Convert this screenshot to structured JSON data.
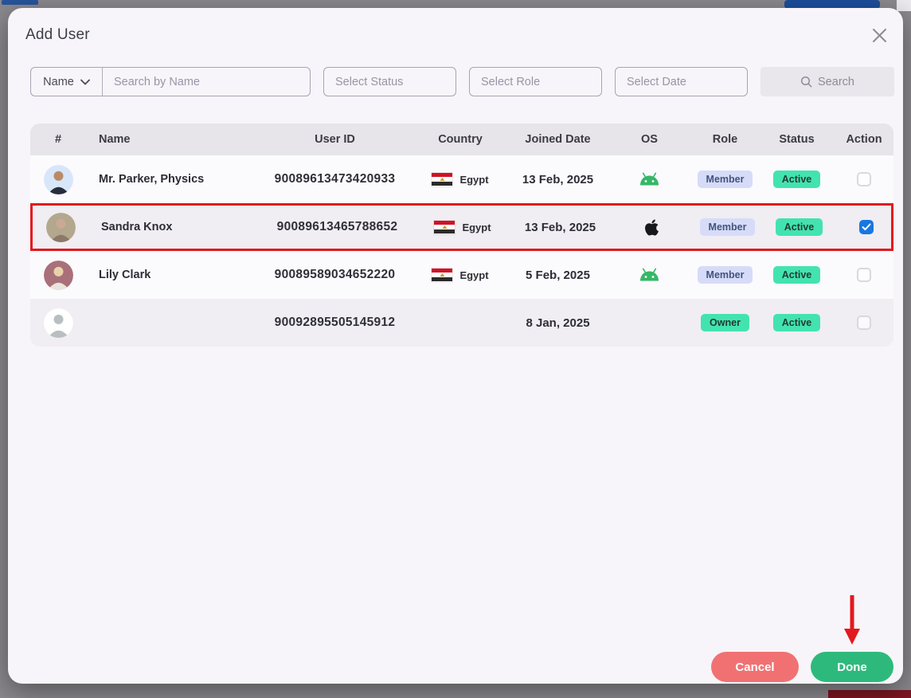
{
  "modal": {
    "title": "Add User"
  },
  "filters": {
    "name_dropdown_label": "Name",
    "search_placeholder": "Search by Name",
    "status_placeholder": "Select Status",
    "role_placeholder": "Select Role",
    "date_placeholder": "Select Date",
    "search_button_label": "Search"
  },
  "table": {
    "columns": [
      "#",
      "Name",
      "User ID",
      "Country",
      "Joined Date",
      "OS",
      "Role",
      "Status",
      "Action"
    ],
    "rows": [
      {
        "name": "Mr. Parker, Physics",
        "user_id": "90089613473420933",
        "country": "Egypt",
        "joined_date": "13 Feb, 2025",
        "os": "android",
        "role": "Member",
        "status": "Active",
        "checked": false,
        "highlighted": false,
        "avatar": "parker"
      },
      {
        "name": "Sandra Knox",
        "user_id": "90089613465788652",
        "country": "Egypt",
        "joined_date": "13 Feb, 2025",
        "os": "apple",
        "role": "Member",
        "status": "Active",
        "checked": true,
        "highlighted": true,
        "avatar": "sandra"
      },
      {
        "name": "Lily Clark",
        "user_id": "90089589034652220",
        "country": "Egypt",
        "joined_date": "5 Feb, 2025",
        "os": "android",
        "role": "Member",
        "status": "Active",
        "checked": false,
        "highlighted": false,
        "avatar": "lily"
      },
      {
        "name": "",
        "user_id": "90092895505145912",
        "country": "",
        "joined_date": "8 Jan, 2025",
        "os": "",
        "role": "Owner",
        "status": "Active",
        "checked": false,
        "highlighted": false,
        "avatar": "placeholder"
      }
    ]
  },
  "footer": {
    "cancel_label": "Cancel",
    "done_label": "Done"
  },
  "colors": {
    "overlay_gray": "#8b898e",
    "modal_bg": "#f7f5f9",
    "table_header_bg": "#e7e4ea",
    "alt_row_bg": "#f0edf3",
    "badge_member_bg": "#d6dcf8",
    "badge_member_text": "#42537f",
    "badge_active_bg": "#43e3af",
    "checkbox_checked_blue": "#1877e0",
    "cancel_red": "#f17173",
    "done_green": "#2eb97c",
    "annotation_red": "#e3191d",
    "android_green": "#35b768",
    "background_button_blue": "#1d4f9c",
    "background_fragment_darkred": "#7c1622"
  }
}
